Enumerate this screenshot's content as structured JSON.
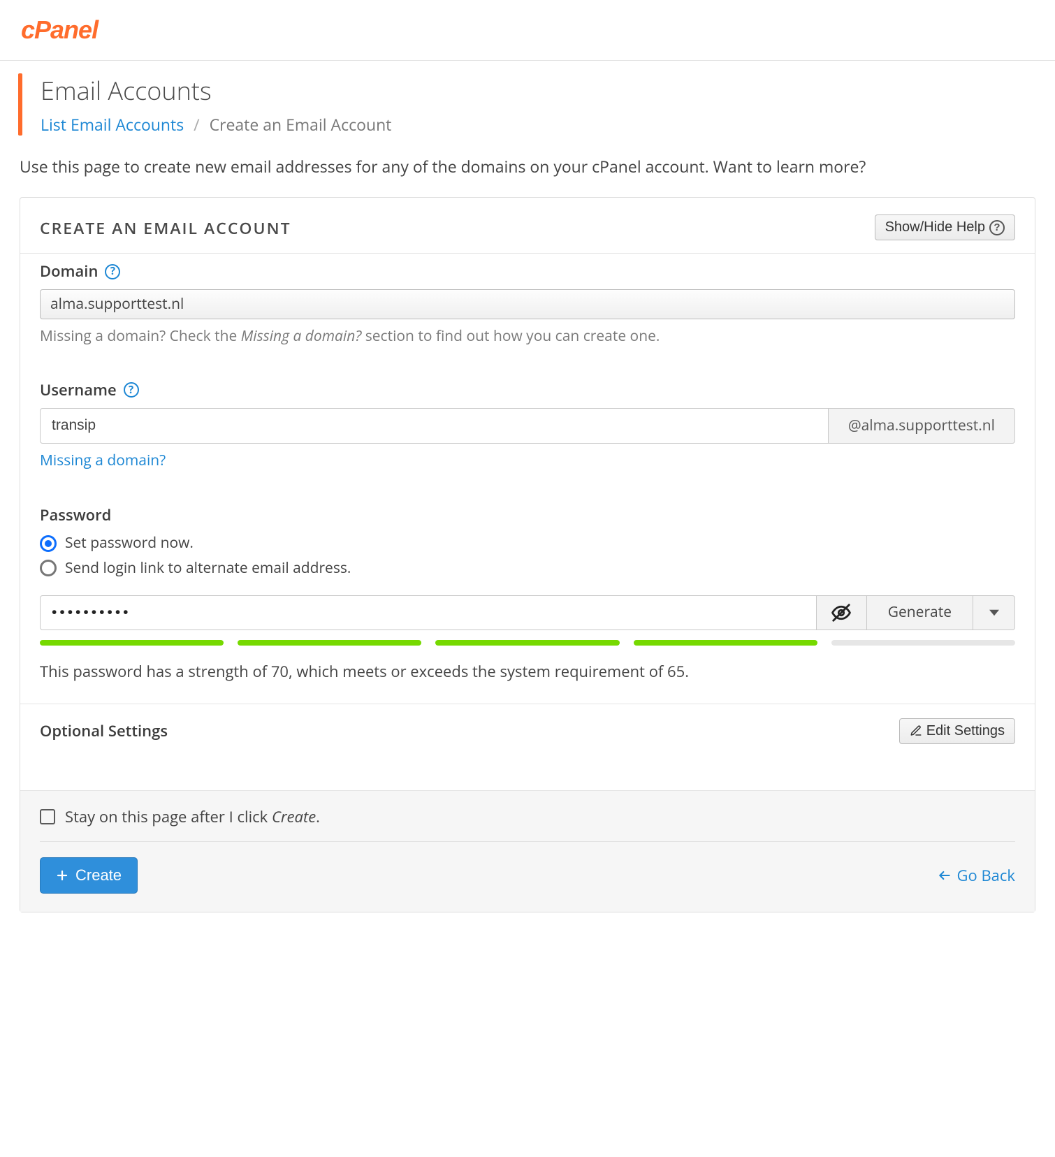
{
  "logo_text": "cPanel",
  "page_title": "Email Accounts",
  "breadcrumb": {
    "link_text": "List Email Accounts",
    "current": "Create an Email Account"
  },
  "page_description": "Use this page to create new email addresses for any of the domains on your cPanel account. Want to learn more?",
  "section_title": "CREATE AN EMAIL ACCOUNT",
  "show_hide_help": "Show/Hide Help",
  "domain": {
    "label": "Domain",
    "value": "alma.supporttest.nl",
    "hint_pre": "Missing a domain? Check the ",
    "hint_em": "Missing a domain?",
    "hint_post": " section to find out how you can create one."
  },
  "username": {
    "label": "Username",
    "value": "transip",
    "addon": "@alma.supporttest.nl",
    "missing_link": "Missing a domain?"
  },
  "password": {
    "label": "Password",
    "opt_now": "Set password now.",
    "opt_send": "Send login link to alternate email address.",
    "selected": "now",
    "mask": "••••••••••",
    "generate_label": "Generate",
    "strength_filled": 4,
    "strength_total": 5,
    "strength_text": "This password has a strength of 70, which meets or exceeds the system requirement of 65."
  },
  "optional": {
    "title": "Optional Settings",
    "edit_label": "Edit Settings"
  },
  "footer": {
    "stay_pre": "Stay on this page after I click ",
    "stay_em": "Create",
    "stay_post": ".",
    "create_label": "Create",
    "goback_label": "Go Back"
  }
}
